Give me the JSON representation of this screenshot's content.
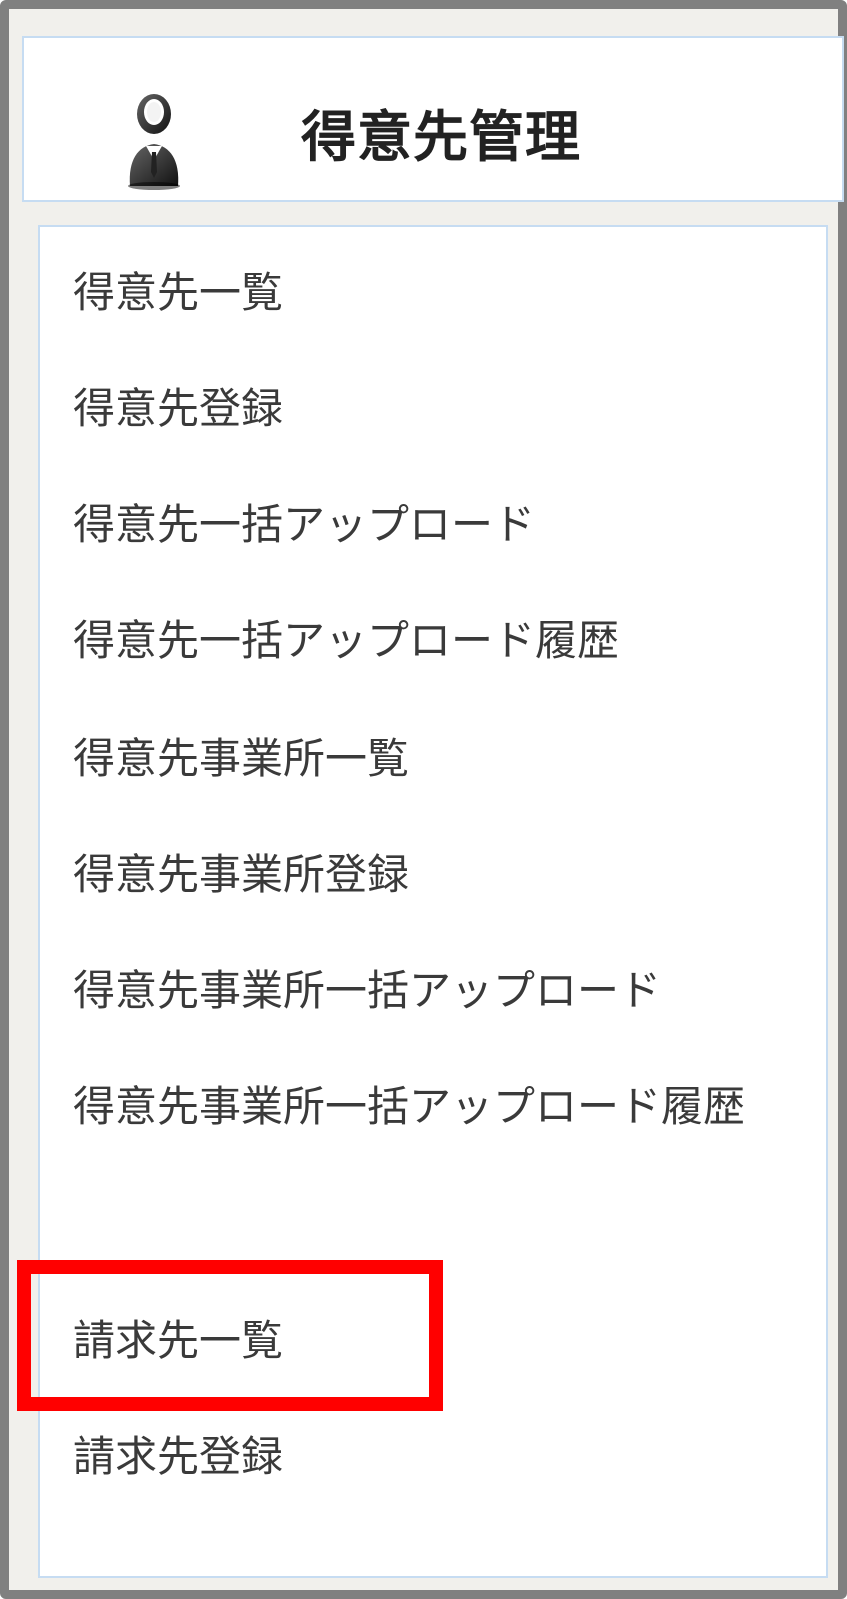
{
  "header": {
    "title": "得意先管理",
    "icon": "user-icon"
  },
  "menu": {
    "items": [
      {
        "label": "得意先一覧"
      },
      {
        "label": "得意先登録"
      },
      {
        "label": "得意先一括アップロード"
      },
      {
        "label": "得意先一括アップロード履歴"
      },
      {
        "label": "得意先事業所一覧"
      },
      {
        "label": "得意先事業所登録"
      },
      {
        "label": "得意先事業所一括アップロード"
      },
      {
        "label": "得意先事業所一括アップロード履歴"
      },
      {
        "label": "請求先一覧"
      },
      {
        "label": "請求先登録"
      }
    ]
  },
  "colors": {
    "frame_border": "#808080",
    "panel_border": "#c6dcf2",
    "highlight": "#ff0000",
    "background": "#f1f0ec"
  }
}
